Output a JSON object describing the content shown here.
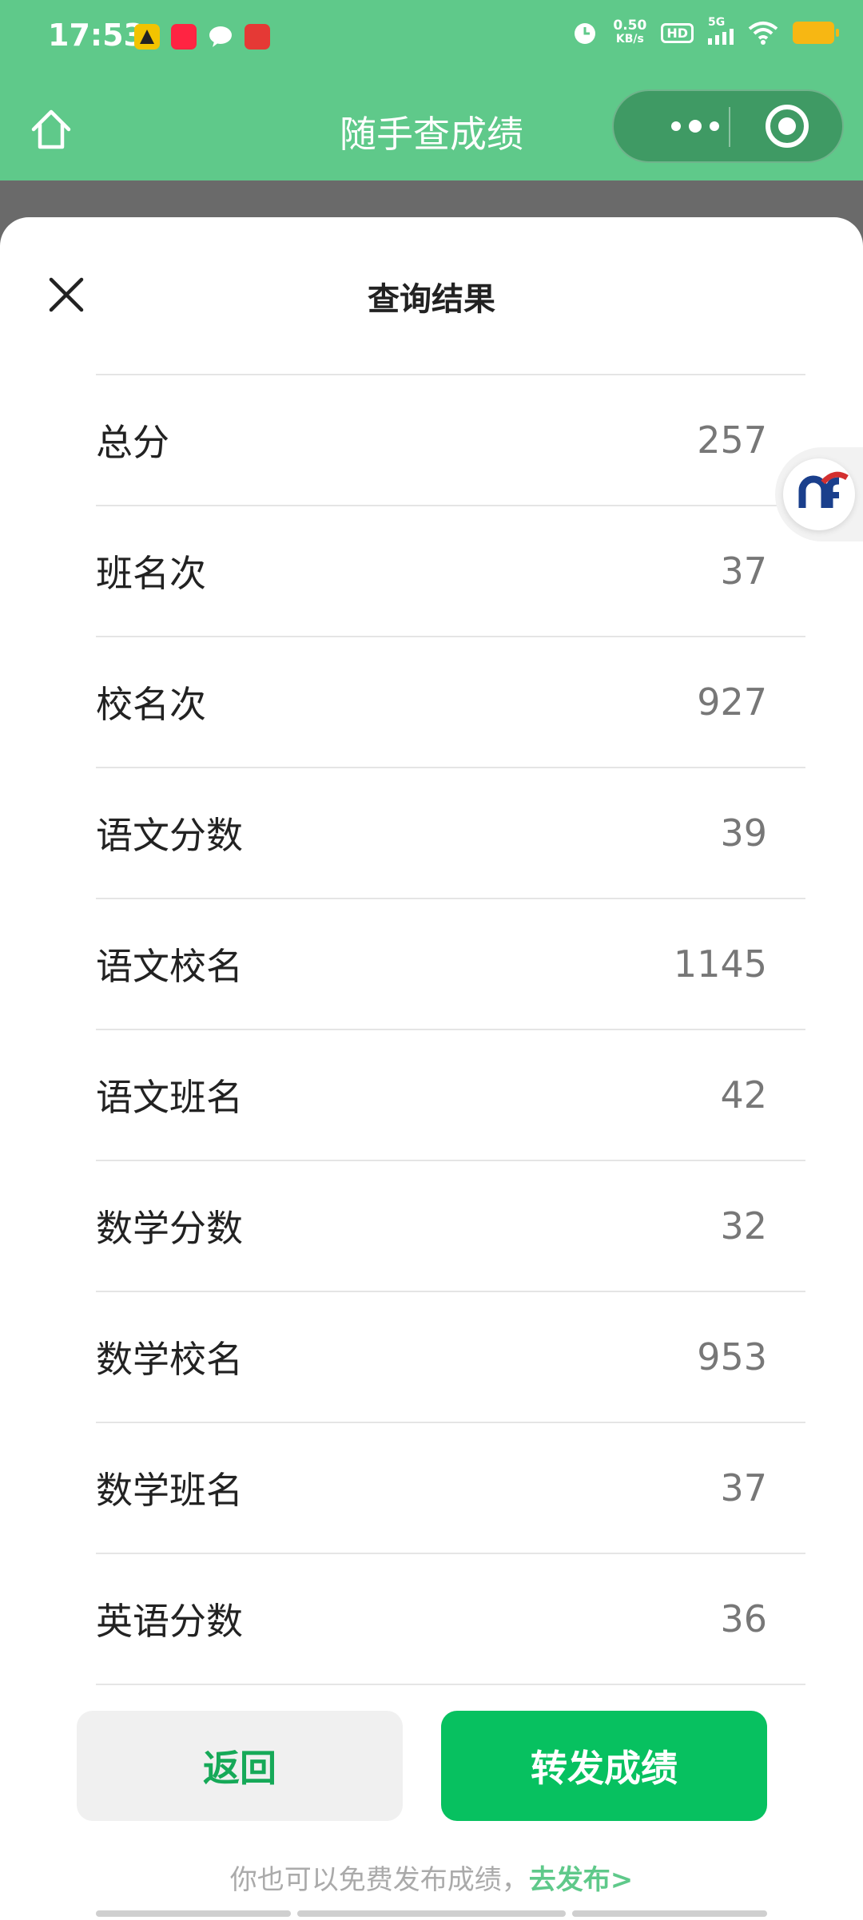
{
  "status_bar": {
    "time": "17:53",
    "net_speed_value": "0.50",
    "net_speed_unit": "KB/s",
    "hd_badge": "HD",
    "network": "5G",
    "app_icons": [
      "navigation-app-icon",
      "xiaohongshu-app-icon",
      "wechat-app-icon",
      "app-notification-icon"
    ],
    "battery_color": "#f7b713"
  },
  "navbar": {
    "title": "随手查成绩",
    "background": "#5fc98a"
  },
  "sheet": {
    "title": "查询结果",
    "rows": [
      {
        "label": "总分",
        "value": "257"
      },
      {
        "label": "班名次",
        "value": "37"
      },
      {
        "label": "校名次",
        "value": "927"
      },
      {
        "label": "语文分数",
        "value": "39"
      },
      {
        "label": "语文校名",
        "value": "1145"
      },
      {
        "label": "语文班名",
        "value": "42"
      },
      {
        "label": "数学分数",
        "value": "32"
      },
      {
        "label": "数学校名",
        "value": "953"
      },
      {
        "label": "数学班名",
        "value": "37"
      },
      {
        "label": "英语分数",
        "value": "36"
      }
    ]
  },
  "actions": {
    "back_label": "返回",
    "share_label": "转发成绩",
    "share_color": "#07c160"
  },
  "footer": {
    "text": "你也可以免费发布成绩，",
    "link_text": "去发布>"
  }
}
